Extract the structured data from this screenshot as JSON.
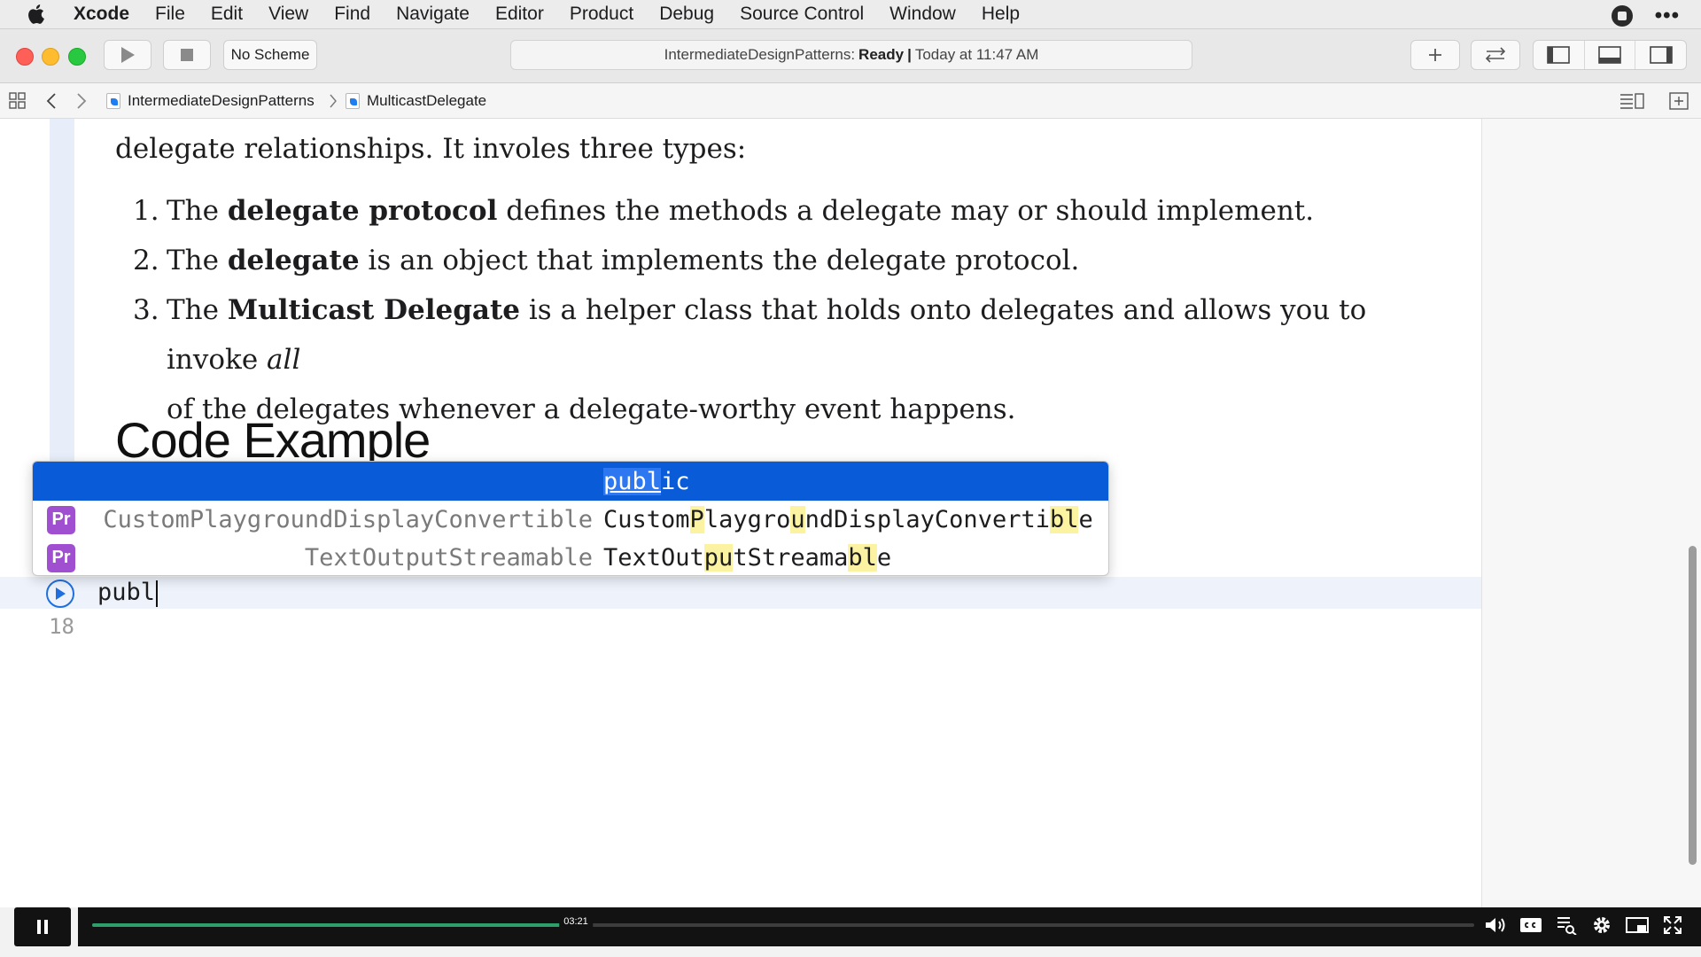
{
  "menubar": {
    "app_name": "Xcode",
    "items": [
      "File",
      "Edit",
      "View",
      "Find",
      "Navigate",
      "Editor",
      "Product",
      "Debug",
      "Source Control",
      "Window",
      "Help"
    ]
  },
  "toolbar": {
    "scheme_label": "No Scheme",
    "activity": {
      "project": "IntermediateDesignPatterns:",
      "status": "Ready",
      "separator": "|",
      "time": "Today at 11:47 AM"
    }
  },
  "jumpbar": {
    "crumbs": [
      "IntermediateDesignPatterns",
      "MulticastDelegate"
    ]
  },
  "doc": {
    "cut_line": "delegate relationships. It involes three types:",
    "list": [
      {
        "num": "1.",
        "pre": "The ",
        "bold": "delegate protocol",
        "post": " defines the methods a delegate may or should implement."
      },
      {
        "num": "2.",
        "pre": "The ",
        "bold": "delegate",
        "post": " is an object that implements the delegate protocol."
      },
      {
        "num": "3.",
        "pre": "The ",
        "bold": "Multicast Delegate",
        "post": " is a helper class that holds onto delegates and allows you to invoke ",
        "italic": "all",
        "line2": "of the delegates whenever a delegate-worthy event happens."
      }
    ],
    "heading": "Code Example"
  },
  "editor": {
    "typed_text": "publ",
    "next_line_number": "18"
  },
  "completion": {
    "selected": {
      "match": "publ",
      "rest": "ic"
    },
    "rows": [
      {
        "icon": "Pr",
        "type": "CustomPlaygroundDisplayConvertible",
        "name_parts": [
          {
            "t": "Custom",
            "h": false
          },
          {
            "t": "P",
            "h": true
          },
          {
            "t": "laygro",
            "h": false
          },
          {
            "t": "u",
            "h": true
          },
          {
            "t": "ndDisplayConverti",
            "h": false
          },
          {
            "t": "bl",
            "h": true
          },
          {
            "t": "e",
            "h": false
          }
        ]
      },
      {
        "icon": "Pr",
        "type": "TextOutputStreamable",
        "name_parts": [
          {
            "t": "TextOut",
            "h": false
          },
          {
            "t": "pu",
            "h": true
          },
          {
            "t": "tStreama",
            "h": false
          },
          {
            "t": "bl",
            "h": true
          },
          {
            "t": "e",
            "h": false
          }
        ]
      }
    ]
  },
  "video": {
    "timestamp": "03:21",
    "progress": 0.35
  },
  "colors": {
    "selection": "#0a5bd8",
    "protocol_icon": "#a04fd1",
    "match_highlight": "#fcf3a2",
    "progress": "#2e9f6b"
  }
}
